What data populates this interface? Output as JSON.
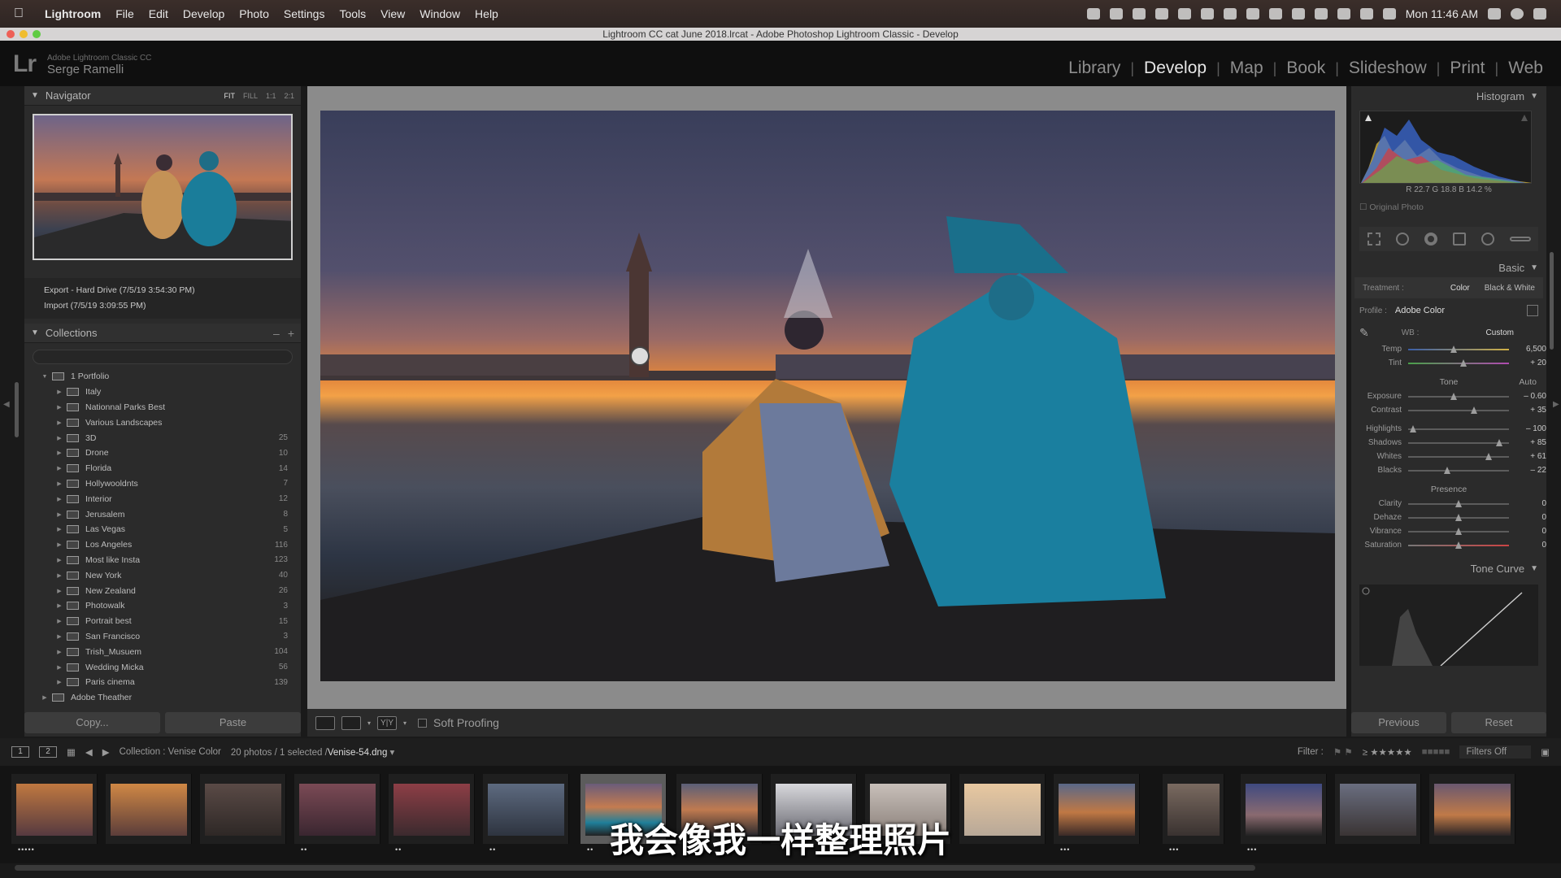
{
  "menubar": {
    "apple_icon": "apple-icon",
    "items": [
      "Lightroom",
      "File",
      "Edit",
      "Develop",
      "Photo",
      "Settings",
      "Tools",
      "View",
      "Window",
      "Help"
    ],
    "clock": "Mon 11:46 AM"
  },
  "window": {
    "title": "Lightroom CC cat June 2018.lrcat - Adobe Photoshop Lightroom Classic - Develop"
  },
  "identity": {
    "logo": "Lr",
    "product": "Adobe Lightroom Classic CC",
    "user": "Serge Ramelli"
  },
  "modules": [
    "Library",
    "Develop",
    "Map",
    "Book",
    "Slideshow",
    "Print",
    "Web"
  ],
  "active_module": "Develop",
  "navigator": {
    "title": "Navigator",
    "zoom_options": [
      "FIT",
      "FILL",
      "1:1",
      "2:1"
    ]
  },
  "history": [
    "Export - Hard Drive (7/5/19 3:54:30 PM)",
    "Import (7/5/19 3:09:55 PM)"
  ],
  "collections": {
    "title": "Collections",
    "minus": "–",
    "plus": "+",
    "root": "1 Portfolio",
    "items": [
      {
        "name": "Italy",
        "count": ""
      },
      {
        "name": "Nationnal Parks Best",
        "count": ""
      },
      {
        "name": "Various Landscapes",
        "count": ""
      },
      {
        "name": "3D",
        "count": "25"
      },
      {
        "name": "Drone",
        "count": "10"
      },
      {
        "name": "Florida",
        "count": "14"
      },
      {
        "name": "Hollywooldnts",
        "count": "7"
      },
      {
        "name": "Interior",
        "count": "12"
      },
      {
        "name": "Jerusalem",
        "count": "8"
      },
      {
        "name": "Las Vegas",
        "count": "5"
      },
      {
        "name": "Los Angeles",
        "count": "116"
      },
      {
        "name": "Most like Insta",
        "count": "123"
      },
      {
        "name": "New York",
        "count": "40"
      },
      {
        "name": "New Zealand",
        "count": "26"
      },
      {
        "name": "Photowalk",
        "count": "3"
      },
      {
        "name": "Portrait best",
        "count": "15"
      },
      {
        "name": "San Francisco",
        "count": "3"
      },
      {
        "name": "Trish_Musuem",
        "count": "104"
      },
      {
        "name": "Wedding Micka",
        "count": "56"
      },
      {
        "name": "Paris cinema",
        "count": "139"
      }
    ],
    "last": "Adobe Theather"
  },
  "left_buttons": {
    "copy": "Copy...",
    "paste": "Paste"
  },
  "toolbar": {
    "soft_proofing": "Soft Proofing",
    "yy": "Y|Y"
  },
  "histogram": {
    "title": "Histogram",
    "values": "R  22.7  G  18.8  B  14.2 %",
    "original_photo": "Original Photo"
  },
  "basic": {
    "title": "Basic",
    "treatment_label": "Treatment :",
    "treatment_color": "Color",
    "treatment_bw": "Black & White",
    "profile_label": "Profile :",
    "profile_value": "Adobe Color",
    "wb_label": "WB :",
    "wb_value": "Custom",
    "temp": {
      "label": "Temp",
      "value": "6,500",
      "pos": 0.45
    },
    "tint": {
      "label": "Tint",
      "value": "+ 20",
      "pos": 0.55
    },
    "tone_label": "Tone",
    "auto": "Auto",
    "exposure": {
      "label": "Exposure",
      "value": "– 0.60",
      "pos": 0.45
    },
    "contrast": {
      "label": "Contrast",
      "value": "+ 35",
      "pos": 0.65
    },
    "highlights": {
      "label": "Highlights",
      "value": "– 100",
      "pos": 0.05
    },
    "shadows": {
      "label": "Shadows",
      "value": "+ 85",
      "pos": 0.9
    },
    "whites": {
      "label": "Whites",
      "value": "+ 61",
      "pos": 0.8
    },
    "blacks": {
      "label": "Blacks",
      "value": "– 22",
      "pos": 0.39
    },
    "presence_label": "Presence",
    "clarity": {
      "label": "Clarity",
      "value": "0",
      "pos": 0.5
    },
    "dehaze": {
      "label": "Dehaze",
      "value": "0",
      "pos": 0.5
    },
    "vibrance": {
      "label": "Vibrance",
      "value": "0",
      "pos": 0.5
    },
    "saturation": {
      "label": "Saturation",
      "value": "0",
      "pos": 0.5
    }
  },
  "tone_curve": {
    "title": "Tone Curve"
  },
  "right_buttons": {
    "previous": "Previous",
    "reset": "Reset"
  },
  "filmstrip_bar": {
    "page1": "1",
    "page2": "2",
    "collection": "Collection : Venise Color",
    "count": "20 photos / 1 selected /",
    "filename": "Venise-54.dng",
    "filter_label": "Filter :",
    "filters_off": "Filters Off"
  },
  "subtitle": "我会像我一样整理照片",
  "colors": {
    "accent": "#e6e6e6",
    "panel": "#2b2b2b",
    "canvas": "#8b8b8b"
  }
}
